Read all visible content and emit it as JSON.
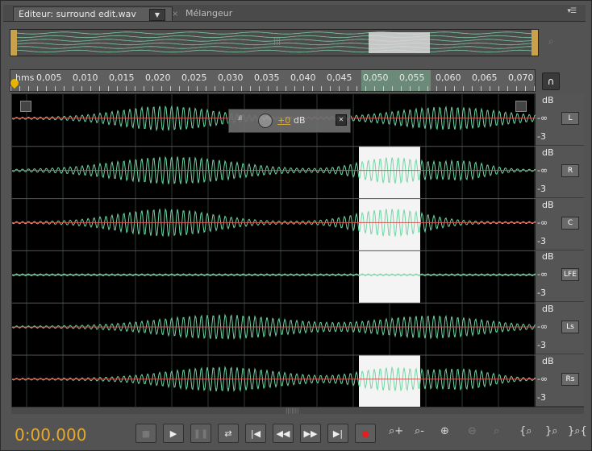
{
  "tabs": {
    "editor_label": "Editeur: surround edit.wav",
    "dropdown_glyph": "▼",
    "close_glyph": "×",
    "mixer_label": "Mélangeur",
    "menu_glyph": "▾☰"
  },
  "overview": {
    "grip": "|||",
    "zoom_icon": "search-icon"
  },
  "ruler": {
    "unit": "hms",
    "labels": [
      "0,005",
      "0,010",
      "0,015",
      "0,020",
      "0,025",
      "0,030",
      "0,035",
      "0,040",
      "0,045",
      "0,050",
      "0,055",
      "0,060",
      "0,065",
      "0,070"
    ],
    "selection_start": 0.05,
    "selection_end": 0.055
  },
  "headphone_glyph": "∩",
  "hud": {
    "value": "+0",
    "unit": "dB",
    "meter": ".ıll",
    "pin": "✕"
  },
  "channels": [
    {
      "button": "L",
      "db": "dB",
      "inf": "-∞",
      "neg": "-3",
      "color": "#d9534f"
    },
    {
      "button": "R",
      "db": "dB",
      "inf": "-∞",
      "neg": "-3",
      "color": "#d9534f"
    },
    {
      "button": "C",
      "db": "dB",
      "inf": "-∞",
      "neg": "-3",
      "color": "#d9534f"
    },
    {
      "button": "LFE",
      "db": "dB",
      "inf": "-∞",
      "neg": "-3",
      "color": "#d9534f"
    },
    {
      "button": "Ls",
      "db": "dB",
      "inf": "-∞",
      "neg": "-3",
      "color": "#d9534f"
    },
    {
      "button": "Rs",
      "db": "dB",
      "inf": "-∞",
      "neg": "-3",
      "color": "#d9534f"
    }
  ],
  "transport": {
    "timecode": "0:00.000",
    "buttons": [
      {
        "name": "stop",
        "glyph": "■",
        "disabled": true
      },
      {
        "name": "play",
        "glyph": "▶",
        "disabled": false
      },
      {
        "name": "pause",
        "glyph": "❚❚",
        "disabled": true
      },
      {
        "name": "loop",
        "glyph": "⇄",
        "disabled": false
      },
      {
        "name": "go-to-start",
        "glyph": "|◀",
        "disabled": false
      },
      {
        "name": "rewind",
        "glyph": "◀◀",
        "disabled": false
      },
      {
        "name": "fast-forward",
        "glyph": "▶▶",
        "disabled": false
      },
      {
        "name": "go-to-end",
        "glyph": "▶|",
        "disabled": false
      },
      {
        "name": "record",
        "glyph": "●",
        "disabled": false
      }
    ],
    "zoom": [
      {
        "name": "zoom-in-amplitude",
        "glyph": "⌕+",
        "disabled": false
      },
      {
        "name": "zoom-out-amplitude",
        "glyph": "⌕-",
        "disabled": false
      },
      {
        "name": "zoom-in-time",
        "glyph": "⊕",
        "disabled": false
      },
      {
        "name": "zoom-out-full",
        "glyph": "⊖",
        "disabled": true
      },
      {
        "name": "zoom-to-selection",
        "glyph": "⌕",
        "disabled": true
      },
      {
        "name": "zoom-in-at-start",
        "glyph": "{⌕",
        "disabled": false
      },
      {
        "name": "zoom-in-at-end",
        "glyph": "}⌕",
        "disabled": false
      },
      {
        "name": "zoom-out-both",
        "glyph": "}⌕{",
        "disabled": false
      }
    ]
  },
  "colors": {
    "accent": "#e6a92a",
    "wave_green": "#6fd6a4",
    "wave_red": "#d9534f",
    "selection": "#f4f4f4"
  }
}
